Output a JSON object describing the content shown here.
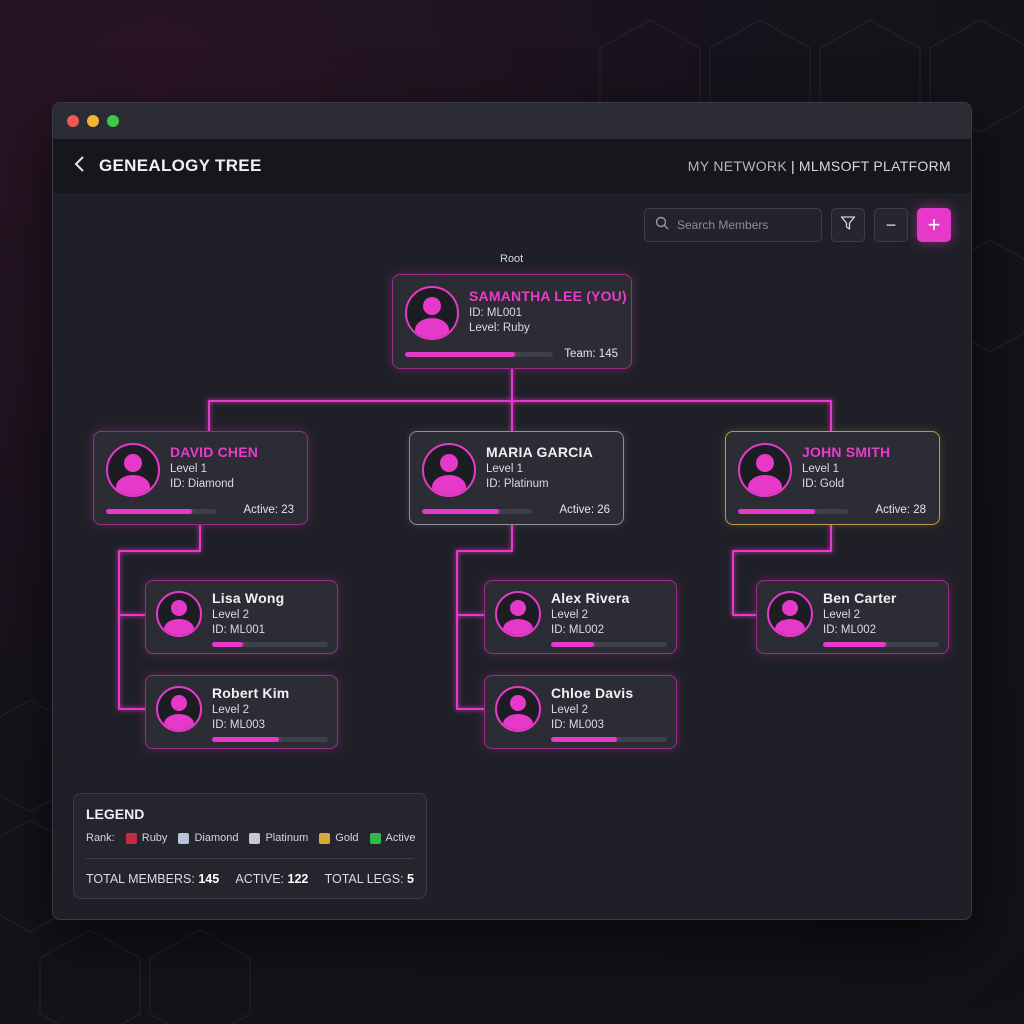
{
  "header": {
    "title": "GENEALOGY TREE",
    "section": "MY NETWORK",
    "separator": "|",
    "platform": "MLMSOFT PLATFORM"
  },
  "toolbar": {
    "search_placeholder": "Search Members",
    "zoom_out": "−",
    "zoom_in": "+"
  },
  "tree": {
    "root_label": "Root",
    "root": {
      "name": "SAMANTHA LEE (YOU)",
      "line1": "ID: ML001",
      "line2": "Level: Ruby",
      "stat": "Team: 145",
      "progress": 0.74
    },
    "level1": [
      {
        "name": "DAVID CHEN",
        "line1": "Level 1",
        "line2": "ID: Diamond",
        "stat": "Active: 23",
        "progress": 0.78
      },
      {
        "name": "MARIA GARCIA",
        "line1": "Level 1",
        "line2": "ID: Platinum",
        "stat": "Active: 26",
        "progress": 0.7
      },
      {
        "name": "JOHN SMITH",
        "line1": "Level 1",
        "line2": "ID: Gold",
        "stat": "Active: 28",
        "progress": 0.7
      }
    ],
    "level2": [
      {
        "name": "Lisa Wong",
        "line1": "Level 2",
        "line2": "ID: ML001",
        "progress": 0.27
      },
      {
        "name": "Robert Kim",
        "line1": "Level 2",
        "line2": "ID: ML003",
        "progress": 0.58
      },
      {
        "name": "Alex Rivera",
        "line1": "Level 2",
        "line2": "ID: ML002",
        "progress": 0.37
      },
      {
        "name": "Chloe Davis",
        "line1": "Level 2",
        "line2": "ID: ML003",
        "progress": 0.57
      },
      {
        "name": "Ben Carter",
        "line1": "Level 2",
        "line2": "ID: ML002",
        "progress": 0.54
      }
    ]
  },
  "legend": {
    "title": "LEGEND",
    "rank_label": "Rank:",
    "items": [
      {
        "label": "Ruby",
        "color": "#c42a45"
      },
      {
        "label": "Diamond",
        "color": "#b9c3dc"
      },
      {
        "label": "Platinum",
        "color": "#c8c8cf"
      },
      {
        "label": "Gold",
        "color": "#d8a93a"
      },
      {
        "label": "Active",
        "color": "#2fb84f"
      }
    ],
    "total_members_label": "TOTAL MEMBERS:",
    "total_members": "145",
    "active_label": "ACTIVE:",
    "active": "122",
    "total_legs_label": "TOTAL LEGS:",
    "total_legs": "5"
  },
  "colors": {
    "accent": "#e639c9",
    "gold_border": "#b89a46",
    "gray_border": "#8e8f98"
  }
}
